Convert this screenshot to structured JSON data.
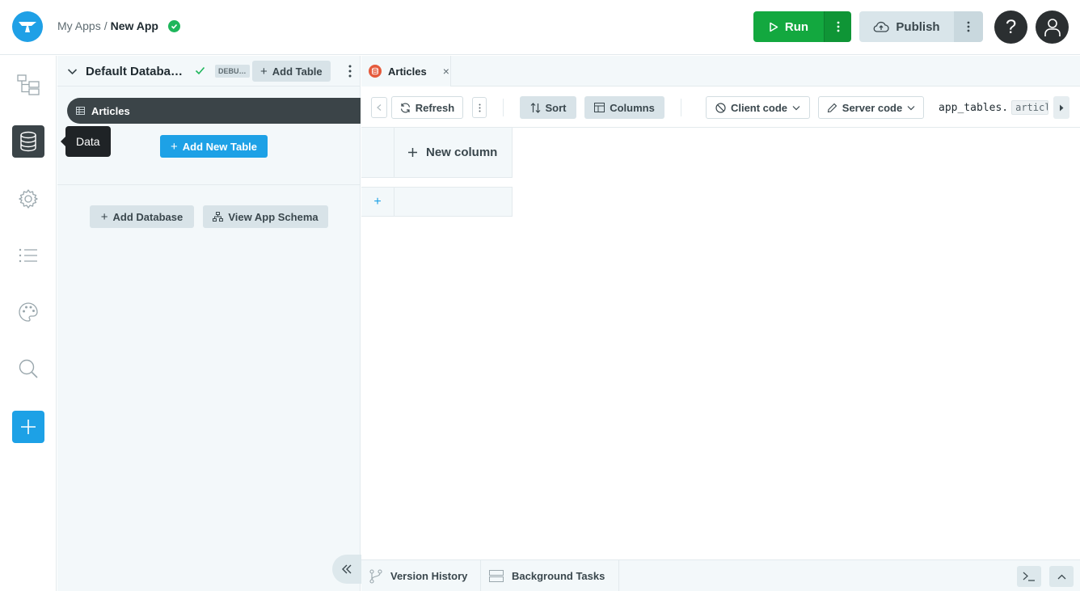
{
  "app": {
    "breadcrumb_root": "My Apps",
    "breadcrumb_sep": "/",
    "app_name": "New App"
  },
  "topbar": {
    "run_label": "Run",
    "publish_label": "Publish",
    "help_label": "?"
  },
  "rail": {
    "tooltip": "Data",
    "items": [
      "app-browser",
      "data",
      "settings",
      "list",
      "theme",
      "search"
    ],
    "active": "data"
  },
  "panel": {
    "db_name": "Default Databa…",
    "debug_badge": "DEBU…",
    "add_table_label": "Add Table",
    "table_item": "Articles",
    "add_new_table_label": "Add New Table",
    "add_database_label": "Add Database",
    "view_schema_label": "View App Schema"
  },
  "editor": {
    "tab_label": "Articles",
    "tab_close": "×",
    "refresh_label": "Refresh",
    "sort_label": "Sort",
    "columns_label": "Columns",
    "client_code_label": "Client code",
    "server_code_label": "Server code",
    "code_prefix": "app_tables.",
    "code_var": "articles",
    "new_column_label": "New column",
    "add_row_label": "+"
  },
  "bottombar": {
    "version_history_label": "Version History",
    "background_tasks_label": "Background Tasks"
  },
  "colors": {
    "accent_blue": "#1da1e6",
    "run_green": "#13a83f",
    "success_green": "#1eb65b",
    "tab_icon_red": "#e55a3c",
    "dark_slate": "#3b4448"
  }
}
